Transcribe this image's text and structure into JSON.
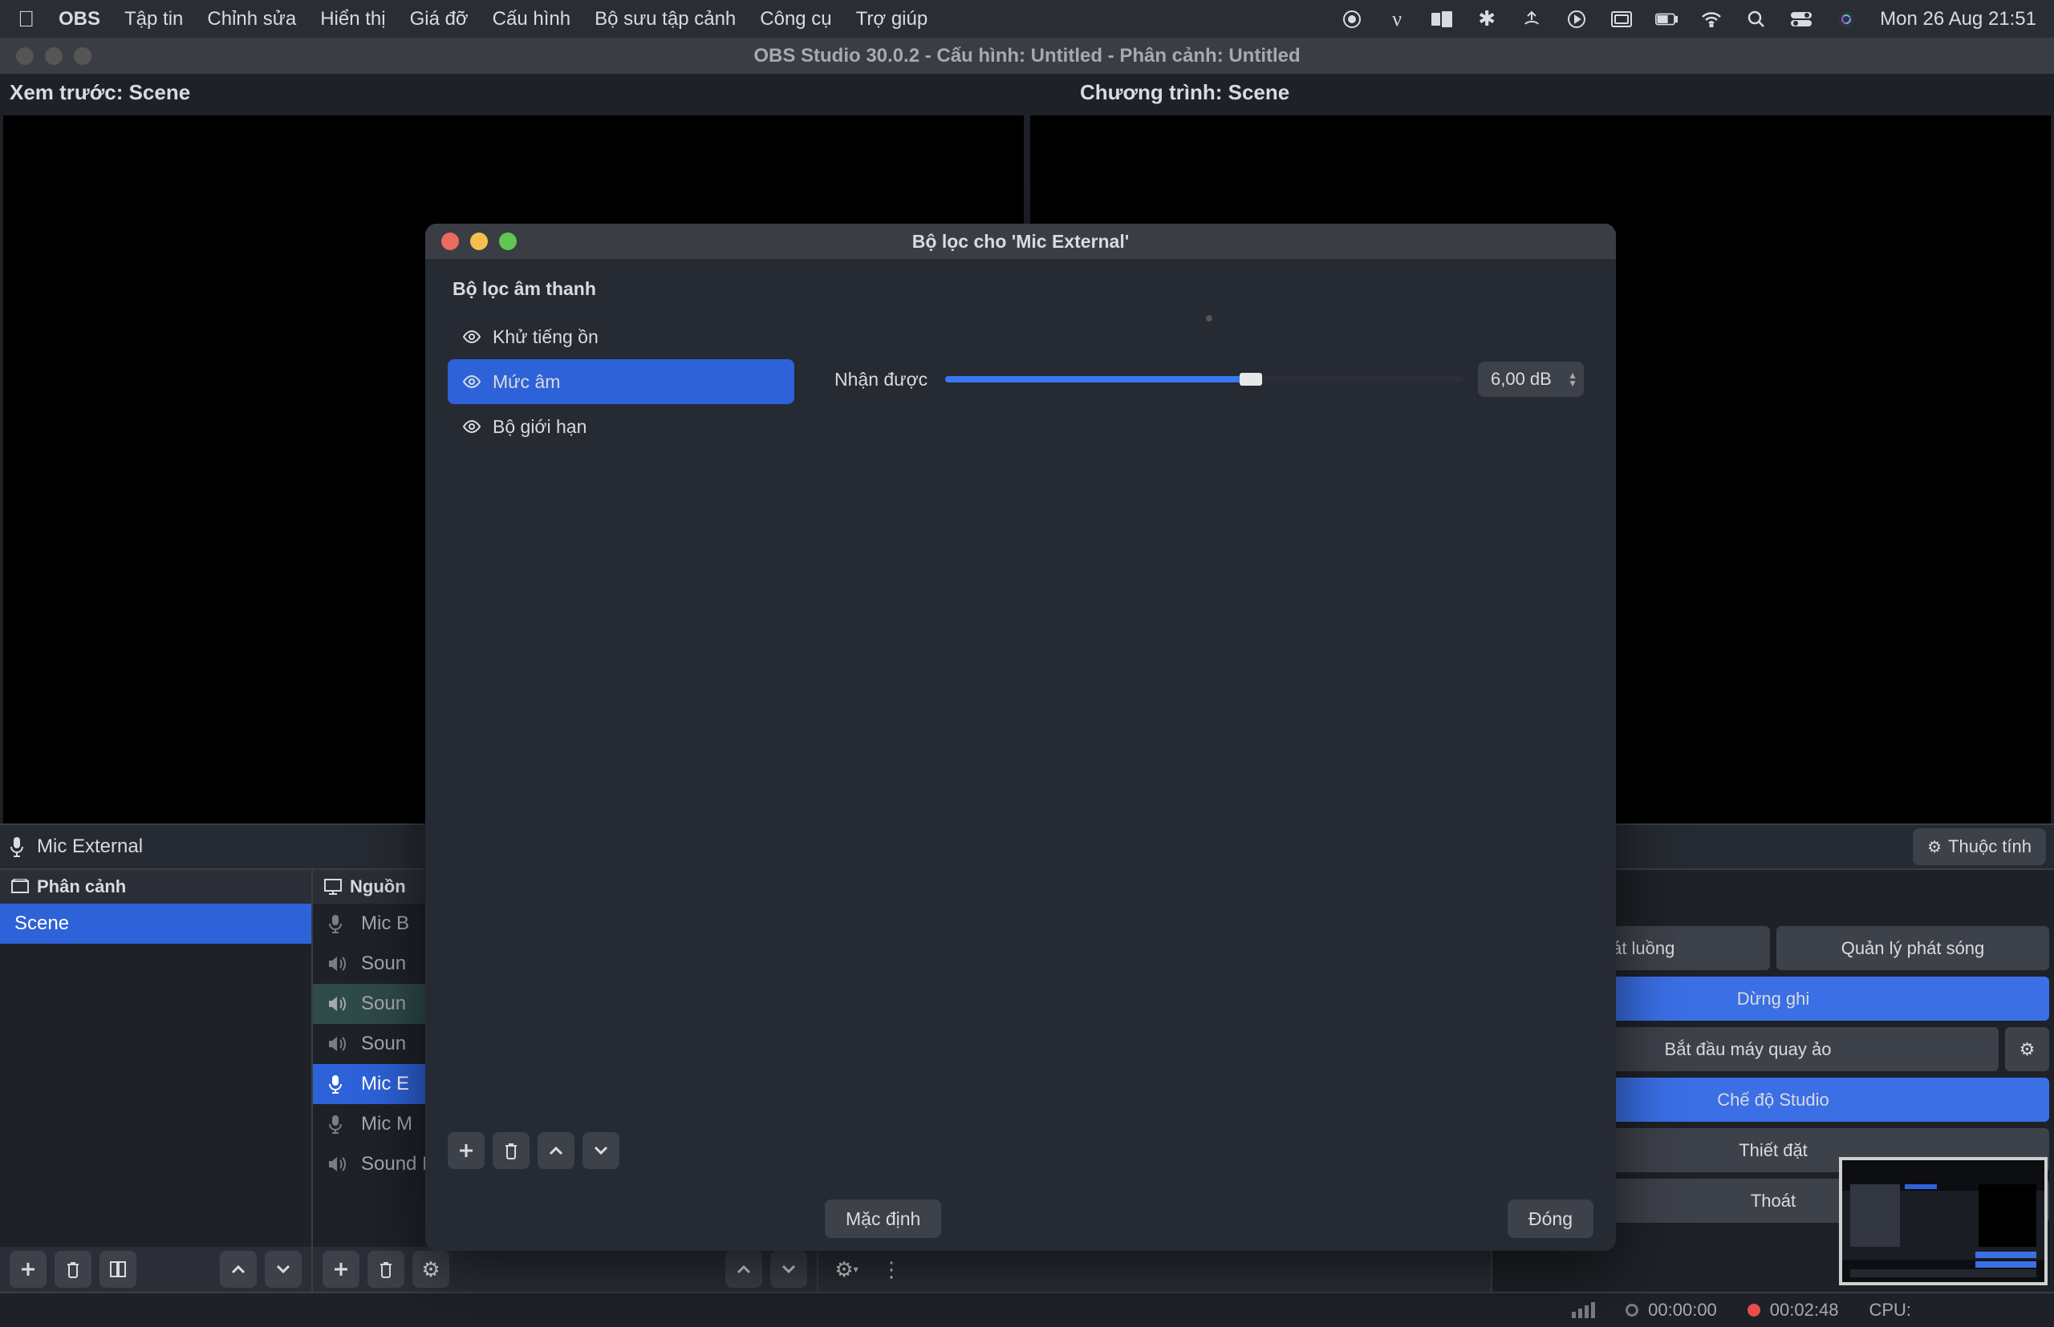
{
  "menubar": {
    "app_name": "OBS",
    "items": [
      "Tập tin",
      "Chỉnh sửa",
      "Hiển thị",
      "Giá đỡ",
      "Cấu hình",
      "Bộ sưu tập cảnh",
      "Công cụ",
      "Trợ giúp"
    ],
    "clock": "Mon 26 Aug  21:51"
  },
  "window": {
    "title": "OBS Studio 30.0.2 - Cấu hình: Untitled - Phân cảnh: Untitled"
  },
  "preview": {
    "left_label": "Xem trước: Scene",
    "right_label": "Chương trình: Scene"
  },
  "context_toolbar": {
    "source_name": "Mic External",
    "properties_label": "Thuộc tính"
  },
  "docks": {
    "scenes_title": "Phân cảnh",
    "sources_title": "Nguồn",
    "scenes": [
      {
        "name": "Scene",
        "selected": true
      }
    ],
    "sources": [
      {
        "name": "Mic B",
        "icon": "mic",
        "selected": false
      },
      {
        "name": "Soun",
        "icon": "speaker",
        "selected": false
      },
      {
        "name": "Soun",
        "icon": "speaker",
        "highlight": true
      },
      {
        "name": "Soun",
        "icon": "speaker",
        "selected": false
      },
      {
        "name": "Mic E",
        "icon": "mic",
        "selected": true
      },
      {
        "name": "Mic M",
        "icon": "mic",
        "selected": false
      },
      {
        "name": "Sound Macbook",
        "icon": "speaker",
        "selected": false
      }
    ]
  },
  "controls": {
    "stream_half": "phát luồng",
    "broadcast_half": "Quản lý phát sóng",
    "stop_record": "Dừng ghi",
    "start_vcam": "Bắt đầu máy quay ảo",
    "studio_mode": "Chế độ Studio",
    "settings": "Thiết đặt",
    "exit": "Thoát"
  },
  "status": {
    "stream_time": "00:00:00",
    "rec_time": "00:02:48",
    "cpu_label": "CPU:"
  },
  "filters_modal": {
    "title": "Bộ lọc cho 'Mic External'",
    "section_title": "Bộ lọc âm thanh",
    "items": [
      {
        "label": "Khử tiếng ồn",
        "selected": false
      },
      {
        "label": "Mức âm",
        "selected": true
      },
      {
        "label": "Bộ giới hạn",
        "selected": false
      }
    ],
    "param_label": "Nhận được",
    "param_value": "6,00 dB",
    "defaults_btn": "Mặc định",
    "close_btn": "Đóng"
  }
}
